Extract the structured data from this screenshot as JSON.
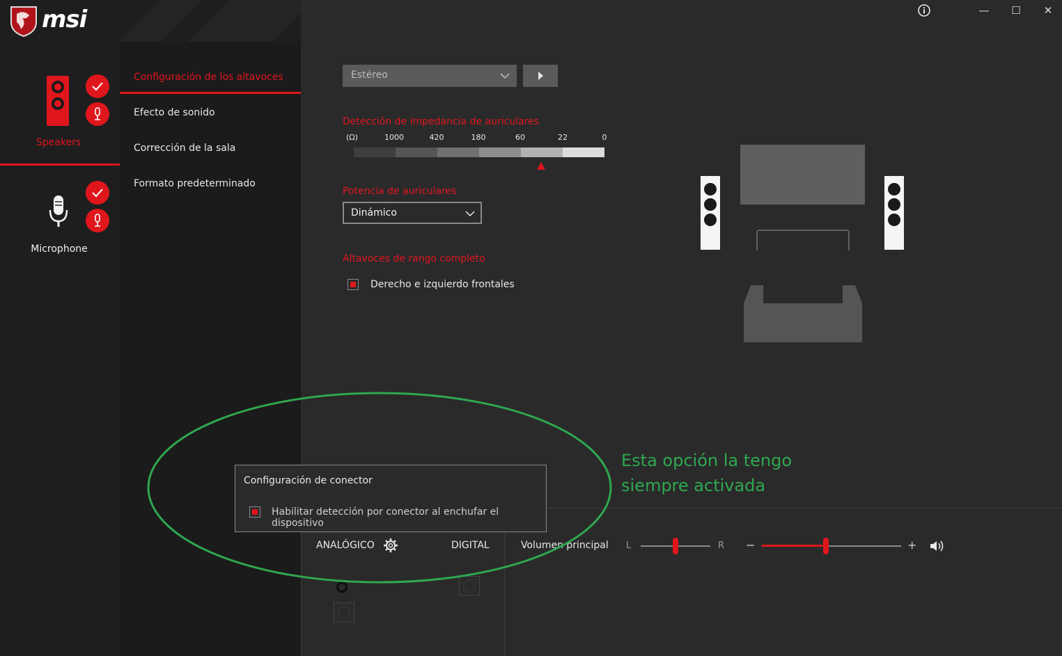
{
  "app": {
    "brand": "msi",
    "accent": "#e0161d",
    "annotation_color": "#2fa84f"
  },
  "window": {
    "info_icon": "info-icon",
    "minimize": "—",
    "maximize": "☐",
    "close": "✕"
  },
  "devices": [
    {
      "label": "Speakers",
      "selected": true
    },
    {
      "label": "Microphone",
      "selected": false
    }
  ],
  "nav": {
    "items": [
      {
        "label": "Configuración de los altavoces",
        "active": true
      },
      {
        "label": "Efecto de sonido"
      },
      {
        "label": "Corrección de la sala"
      },
      {
        "label": "Formato predeterminado"
      }
    ]
  },
  "speaker_config": {
    "mode_value": "Estéreo",
    "impedance_title": "Detección de impedancia de auriculares",
    "impedance_unit": "(Ω)",
    "impedance_ticks": [
      "1000",
      "420",
      "180",
      "60",
      "22",
      "0"
    ],
    "power_title": "Potencia de auriculares",
    "power_value": "Dinámico",
    "fullrange_title": "Altavoces de rango completo",
    "fullrange_option": "Derecho e izquierdo frontales"
  },
  "connector_popup": {
    "title": "Configuración de conector",
    "option": "Habilitar detección por conector al enchufar el dispositivo"
  },
  "annotation": {
    "line1": "Esta opción la tengo",
    "line2": "siempre activada"
  },
  "bottom_bar": {
    "analog_label": "ANALÓGICO",
    "digital_label": "DIGITAL",
    "volume_label": "Volumen principal",
    "balance_left": "L",
    "balance_right": "R",
    "minus": "−",
    "plus": "+",
    "balance_level": 0.5,
    "volume_level": 0.46
  }
}
